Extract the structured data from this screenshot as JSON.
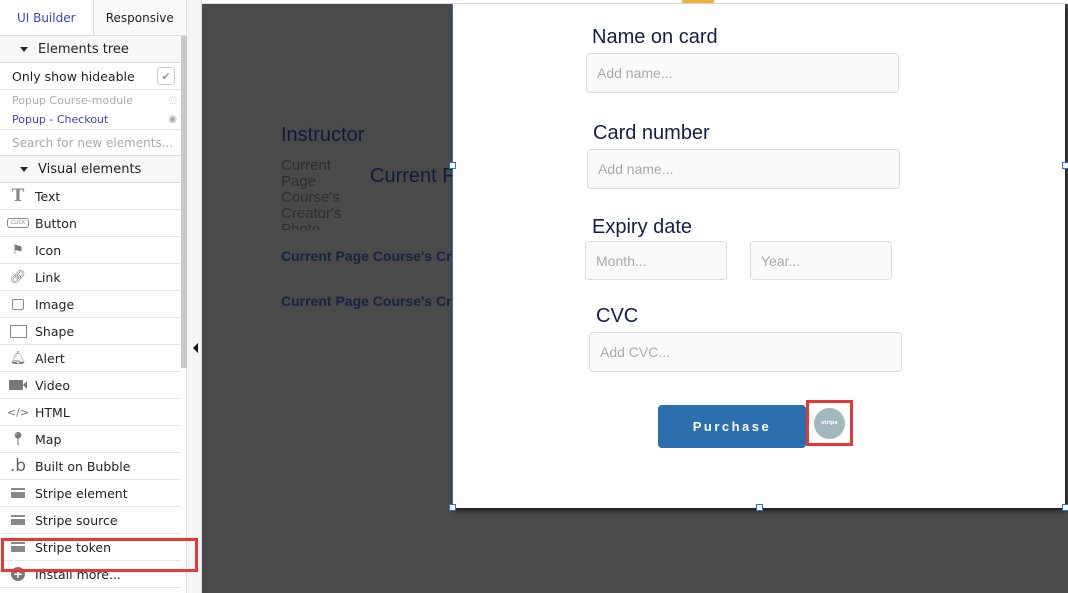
{
  "tabs": [
    {
      "label": "UI Builder"
    },
    {
      "label": "Responsive"
    }
  ],
  "elements_tree": {
    "header": "Elements tree",
    "only_show_hideable": "Only show hideable",
    "only_show_hideable_checked": true,
    "items": [
      {
        "label": "Popup Course-module",
        "state": "hidden"
      },
      {
        "label": "Popup - Checkout",
        "state": "visible"
      }
    ],
    "search_placeholder": "Search for new elements..."
  },
  "visual_elements": {
    "header": "Visual elements",
    "items": [
      {
        "label": "Text",
        "icon": "text-icon"
      },
      {
        "label": "Button",
        "icon": "button-icon"
      },
      {
        "label": "Icon",
        "icon": "flag-icon"
      },
      {
        "label": "Link",
        "icon": "link-icon"
      },
      {
        "label": "Image",
        "icon": "image-icon"
      },
      {
        "label": "Shape",
        "icon": "shape-icon"
      },
      {
        "label": "Alert",
        "icon": "bell-icon"
      },
      {
        "label": "Video",
        "icon": "video-icon"
      },
      {
        "label": "HTML",
        "icon": "code-icon"
      },
      {
        "label": "Map",
        "icon": "map-pin-icon"
      },
      {
        "label": "Built on Bubble",
        "icon": "bubble-logo-icon"
      },
      {
        "label": "Stripe element",
        "icon": "card-icon"
      },
      {
        "label": "Stripe source",
        "icon": "card-icon"
      },
      {
        "label": "Stripe token",
        "icon": "card-icon",
        "highlighted": true
      },
      {
        "label": "Install more...",
        "icon": "plus-circle-icon"
      }
    ]
  },
  "background_page": {
    "instructor_heading": "Instructor",
    "photo_placeholder": "Current Page Course's Creator's Photo",
    "current_name": "Current Page Course's Creator's Name",
    "line1": "Current Page Course's Creator's Bio",
    "line2": "Current Page Course's Creator's Email"
  },
  "checkout_popup": {
    "name_label": "Name on card",
    "name_placeholder": "Add name...",
    "card_label": "Card number",
    "card_placeholder": "Add name...",
    "expiry_label": "Expiry date",
    "month_placeholder": "Month...",
    "year_placeholder": "Year...",
    "cvc_label": "CVC",
    "cvc_placeholder": "Add CVC...",
    "purchase_label": "Purchase",
    "stripe_badge": "stripe"
  },
  "colors": {
    "accent_blue": "#3b3fd0",
    "button_blue": "#2b6fae",
    "highlight_red": "#e53935",
    "label_navy": "#151d4a"
  }
}
